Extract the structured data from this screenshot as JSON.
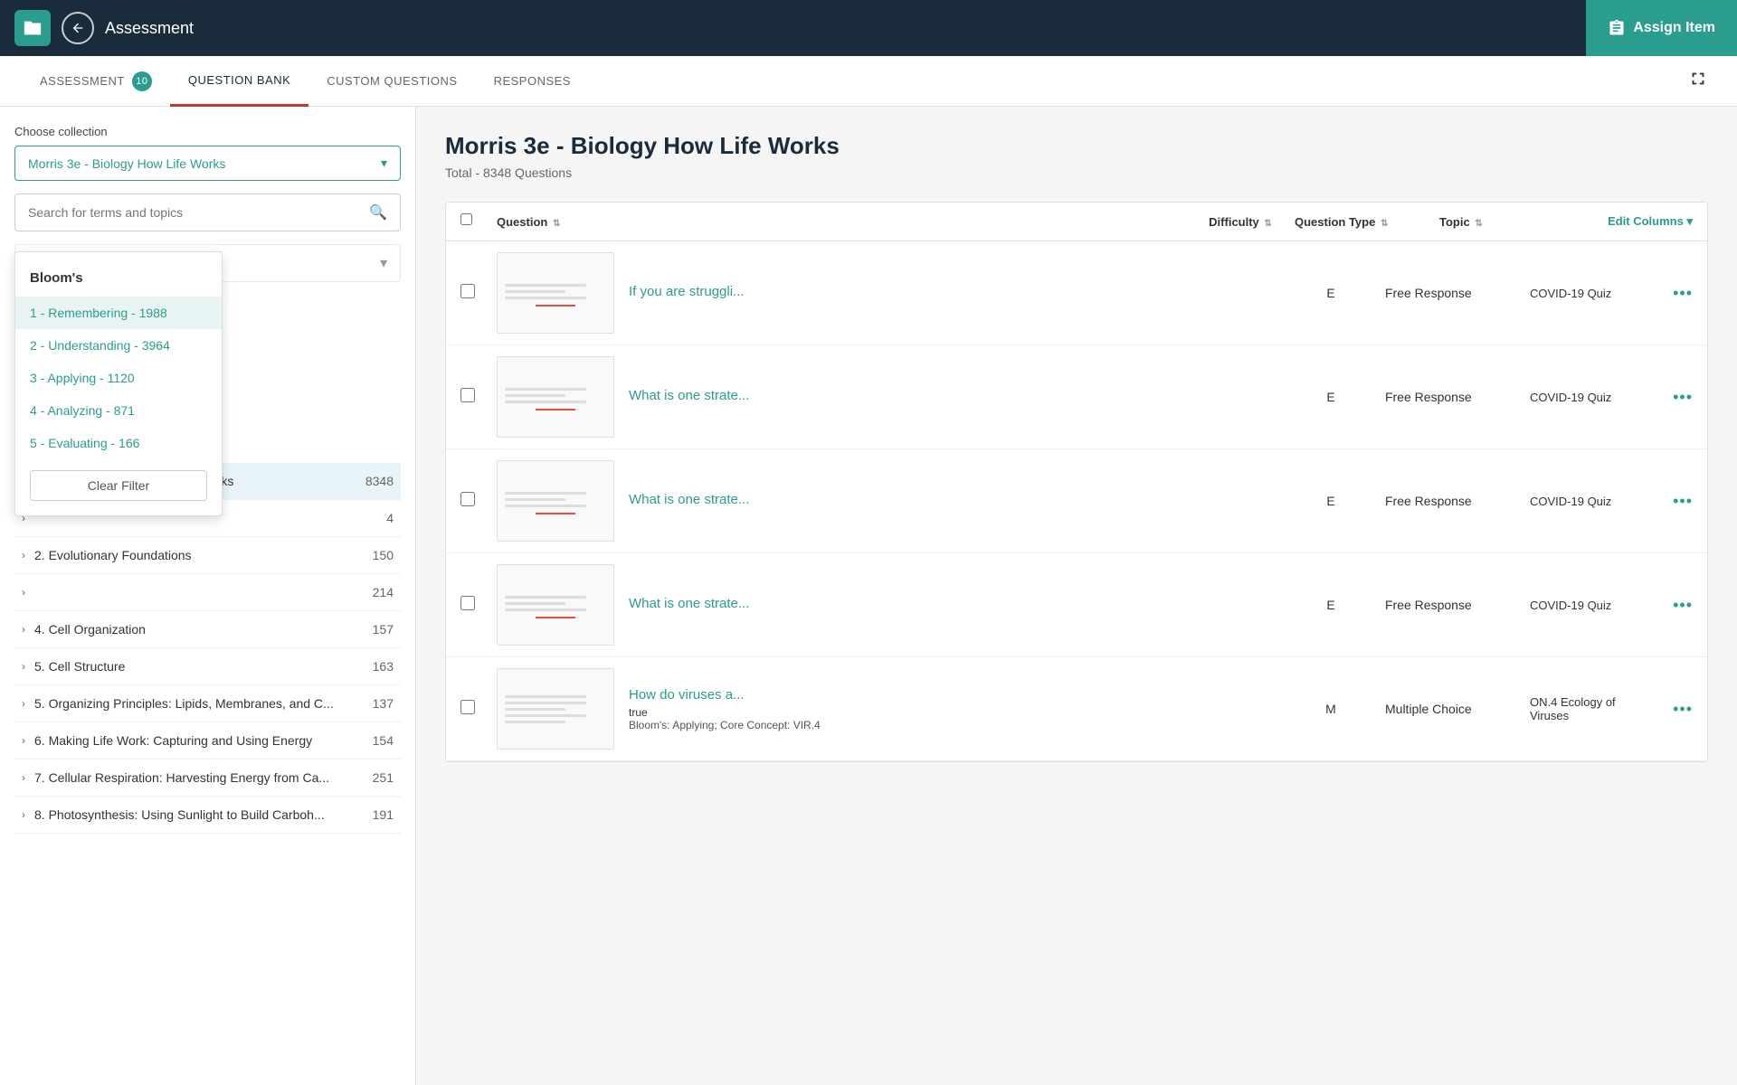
{
  "topNav": {
    "title": "Assessment",
    "assignLabel": "Assign Item",
    "helpIcon": "?"
  },
  "tabs": [
    {
      "id": "assessment",
      "label": "ASSESSMENT",
      "badge": "10",
      "active": false
    },
    {
      "id": "question-bank",
      "label": "QUESTION BANK",
      "badge": null,
      "active": true
    },
    {
      "id": "custom-questions",
      "label": "CUSTOM QUESTIONS",
      "badge": null,
      "active": false
    },
    {
      "id": "responses",
      "label": "RESPONSES",
      "badge": null,
      "active": false
    }
  ],
  "sidebar": {
    "chooseCollectionLabel": "Choose collection",
    "collectionValue": "Morris 3e - Biology How Life Works",
    "searchPlaceholder": "Search for terms and topics",
    "filterPlaceholder": "Bloom's",
    "bloomsDropdown": {
      "header": "Bloom's",
      "items": [
        {
          "label": "1 - Remembering - 1988",
          "selected": true
        },
        {
          "label": "2 - Understanding - 3964",
          "selected": false
        },
        {
          "label": "3 - Applying - 1120",
          "selected": false
        },
        {
          "label": "4 - Analyzing - 871",
          "selected": false
        },
        {
          "label": "5 - Evaluating - 166",
          "selected": false
        }
      ],
      "clearLabel": "Clear Filter"
    },
    "chapters": [
      {
        "label": "Morris 3e - Biology How Life Works",
        "count": 8348,
        "active": true,
        "open": true
      },
      {
        "label": "",
        "count": 4,
        "active": false,
        "open": false
      },
      {
        "label": "2. Evolutionary Foundations",
        "count": 150,
        "active": false,
        "open": false
      },
      {
        "label": "",
        "count": 214,
        "active": false,
        "open": false
      },
      {
        "label": "4. Cell Organization",
        "count": 157,
        "active": false,
        "open": false
      },
      {
        "label": "5. Cell Structure",
        "count": 163,
        "active": false,
        "open": false
      },
      {
        "label": "5. Organizing Principles: Lipids, Membranes, and C...",
        "count": 137,
        "active": false,
        "open": false
      },
      {
        "label": "6. Making Life Work: Capturing and Using Energy",
        "count": 154,
        "active": false,
        "open": false
      },
      {
        "label": "7. Cellular Respiration: Harvesting Energy from Ca...",
        "count": 251,
        "active": false,
        "open": false
      },
      {
        "label": "8. Photosynthesis: Using Sunlight to Build Carboh...",
        "count": 191,
        "active": false,
        "open": false
      }
    ]
  },
  "main": {
    "title": "Morris 3e - Biology How Life Works",
    "subtitle": "Total - 8348 Questions",
    "table": {
      "columns": {
        "question": "Question",
        "difficulty": "Difficulty",
        "questionType": "Question Type",
        "topic": "Topic",
        "editColumns": "Edit Columns"
      },
      "rows": [
        {
          "questionText": "If you are struggli...",
          "difficulty": "E",
          "questionType": "Free Response",
          "topic": "COVID-19 Quiz",
          "customizable": false,
          "blooms": null
        },
        {
          "questionText": "What is one strate...",
          "difficulty": "E",
          "questionType": "Free Response",
          "topic": "COVID-19 Quiz",
          "customizable": false,
          "blooms": null
        },
        {
          "questionText": "What is one strate...",
          "difficulty": "E",
          "questionType": "Free Response",
          "topic": "COVID-19 Quiz",
          "customizable": false,
          "blooms": null
        },
        {
          "questionText": "What is one strate...",
          "difficulty": "E",
          "questionType": "Free Response",
          "topic": "COVID-19 Quiz",
          "customizable": false,
          "blooms": null
        },
        {
          "questionText": "How do viruses a...",
          "difficulty": "M",
          "questionType": "Multiple Choice",
          "topic": "ON.4 Ecology of Viruses",
          "customizable": true,
          "blooms": "Bloom's: Applying; Core Concept: VIR.4"
        }
      ]
    }
  }
}
